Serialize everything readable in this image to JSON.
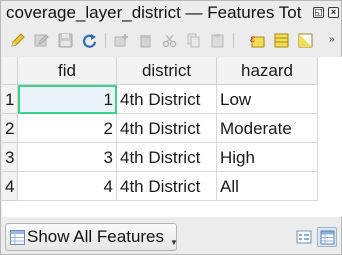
{
  "window": {
    "title": "coverage_layer_district — Features Tot",
    "float_icon": "float-icon",
    "close_icon": "close-icon"
  },
  "toolbar": {
    "icons": [
      "pencil-edit-icon",
      "multi-edit-icon",
      "save-icon",
      "reload-icon",
      "add-feature-icon",
      "delete-feature-icon",
      "cut-icon",
      "copy-icon",
      "paste-icon",
      "expression-select-icon",
      "select-all-icon",
      "invert-selection-icon"
    ],
    "overflow": "»"
  },
  "table": {
    "columns": [
      "fid",
      "district",
      "hazard"
    ],
    "rows": [
      {
        "num": "1",
        "fid": "1",
        "district": "4th District",
        "hazard": "Low"
      },
      {
        "num": "2",
        "fid": "2",
        "district": "4th District",
        "hazard": "Moderate"
      },
      {
        "num": "3",
        "fid": "3",
        "district": "4th District",
        "hazard": "High"
      },
      {
        "num": "4",
        "fid": "4",
        "district": "4th District",
        "hazard": "All"
      }
    ],
    "selected_cell": {
      "row": 1,
      "column": "fid"
    }
  },
  "filter": {
    "label": "Show All Features",
    "icon": "table-filter-icon"
  },
  "view_toggle": {
    "form_icon": "form-view-icon",
    "table_icon": "table-view-icon",
    "active": "table"
  },
  "colors": {
    "selection_border": "#3dd38b",
    "selection_fill": "#e9f2fa",
    "header_bg": "#f3f3f3"
  }
}
